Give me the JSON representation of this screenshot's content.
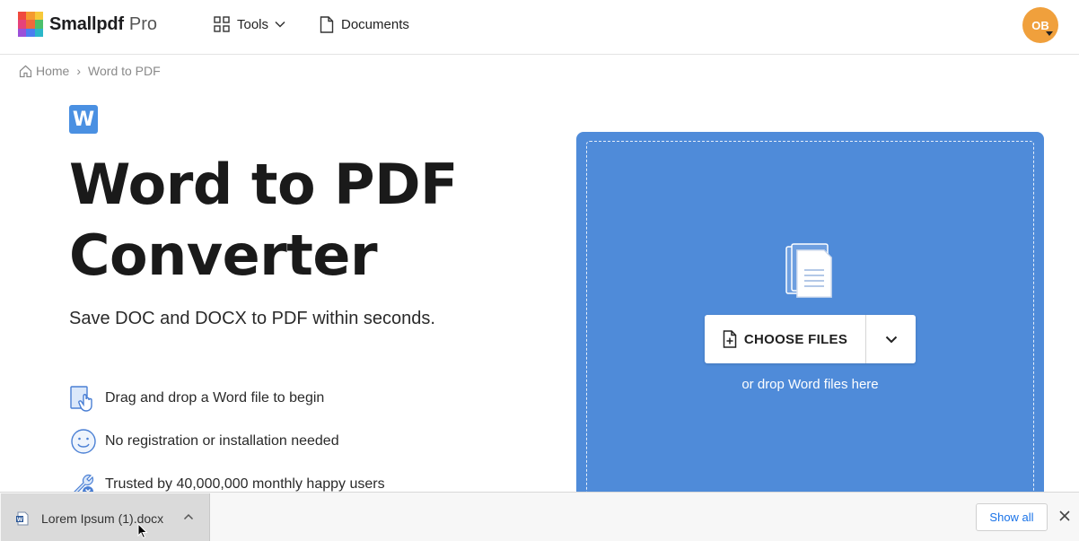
{
  "header": {
    "brand": "Smallpdf",
    "brand_suffix": "Pro",
    "nav": [
      {
        "label": "Tools",
        "icon": "grid-icon"
      },
      {
        "label": "Documents",
        "icon": "document-icon"
      }
    ],
    "avatar_initials": "OB",
    "avatar_color": "#f0a03c"
  },
  "breadcrumb": {
    "home": "Home",
    "separator": "›",
    "current": "Word to PDF"
  },
  "hero": {
    "badge_letter": "W",
    "title_line1": "Word to PDF",
    "title_line2": "Converter",
    "subtitle": "Save DOC and DOCX to PDF within seconds.",
    "features": [
      {
        "icon": "drag-hand-icon",
        "text": "Drag and drop a Word file to begin"
      },
      {
        "icon": "smiley-icon",
        "text": "No registration or installation needed"
      },
      {
        "icon": "tools-icon",
        "text": "Trusted by 40,000,000 monthly happy users"
      }
    ]
  },
  "upload": {
    "button_label": "CHOOSE FILES",
    "drop_hint": "or drop Word files here",
    "zone_color": "#4f8bd9"
  },
  "downloads": {
    "file_name": "Lorem Ipsum (1).docx",
    "show_all": "Show all"
  }
}
